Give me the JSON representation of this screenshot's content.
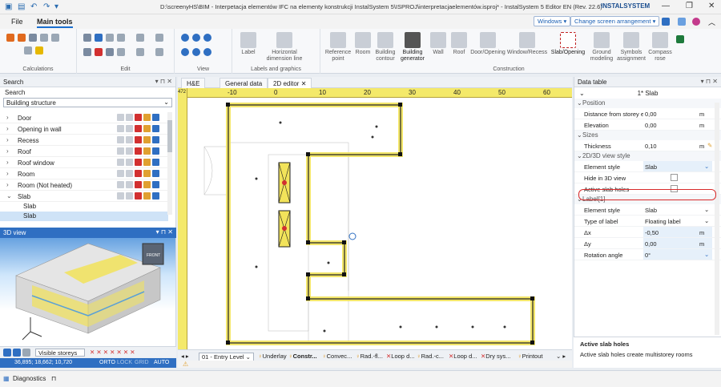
{
  "window": {
    "title": "D:\\screenyHS\\BIM - Interpetacja elementów IFC na elementy konstrukcji InstalSystem 5\\ISPROJ\\interpretacjaelementów.isproj* - InstalSystem 5 Editor EN (Rev. 22.6)",
    "brand": "INSTALSYSTEM"
  },
  "menu": {
    "items": [
      "File",
      "Main tools"
    ],
    "windows_label": "Windows",
    "arrangement_label": "Change screen arrangement"
  },
  "ribbon": {
    "groups": [
      "Calculations",
      "Edit",
      "View",
      "Labels and graphics",
      "Construction"
    ],
    "label_buttons": [
      "Label",
      "Horizontal dimension line"
    ],
    "construction_buttons": [
      "Reference point",
      "Room",
      "Building contour",
      "Building generator",
      "Wall",
      "Roof",
      "Door/Opening",
      "Window/Recess",
      "Slab/Opening",
      "Ground modeling",
      "Symbols assignment",
      "Compass rose"
    ]
  },
  "search_panel": {
    "title": "Search",
    "label": "Search",
    "combo_value": "Building structure",
    "items": [
      "Door",
      "Opening in wall",
      "Recess",
      "Roof",
      "Roof window",
      "Room",
      "Room (Not heated)",
      "Slab"
    ],
    "sub_items": [
      "Slab",
      "Slab"
    ]
  },
  "view3d": {
    "title": "3D view",
    "cube_label": "FRONT",
    "toolbar_label": "Visible storeys",
    "status": {
      "coords": "36,895; 18,662; 10,720",
      "modes": [
        "ORTO",
        "LOCK",
        "GRID",
        "AUTO"
      ]
    }
  },
  "editor": {
    "tabs": [
      "H&E",
      "General data",
      "2D editor"
    ],
    "ruler_top": [
      "-10",
      "0",
      "10",
      "20",
      "30",
      "40",
      "50",
      "60"
    ],
    "ruler_corner": "472",
    "bottom_items": [
      "01 - Entry Level",
      "Underlay",
      "Constr...",
      "Convec...",
      "Rad.-fl...",
      "Loop d...",
      "Rad.-c...",
      "Loop d...",
      "Dry sys...",
      "Printout"
    ]
  },
  "data_table": {
    "title": "Data table",
    "selection": "1* Slab",
    "sections": {
      "position": "Position",
      "sizes": "Sizes",
      "view": "2D/3D view style",
      "label": "Label[1]"
    },
    "position_rows": [
      {
        "k": "Distance from storey el",
        "v": "0,00",
        "u": "m"
      },
      {
        "k": "Elevation",
        "v": "0,00",
        "u": "m"
      }
    ],
    "sizes_rows": [
      {
        "k": "Thickness",
        "v": "0,10",
        "u": "m"
      }
    ],
    "view_rows": [
      {
        "k": "Element style",
        "v": "Slab"
      },
      {
        "k": "Hide in 3D view",
        "v": ""
      },
      {
        "k": "Active slab holes",
        "v": ""
      }
    ],
    "label_rows": [
      {
        "k": "Element style",
        "v": "Slab"
      },
      {
        "k": "Type of label",
        "v": "Floating label"
      },
      {
        "k": "Δx",
        "v": "-0,50",
        "u": "m"
      },
      {
        "k": "Δy",
        "v": "0,00",
        "u": "m"
      },
      {
        "k": "Rotation angle",
        "v": "0°"
      }
    ],
    "info_title": "Active slab holes",
    "info_text": "Active slab holes create multistorey rooms"
  },
  "diagnostics": {
    "title": "Diagnostics"
  },
  "colors": {
    "accent": "#1a6fd0",
    "slab_yellow": "#f2e35a",
    "highlight_red": "#d92b2b"
  }
}
